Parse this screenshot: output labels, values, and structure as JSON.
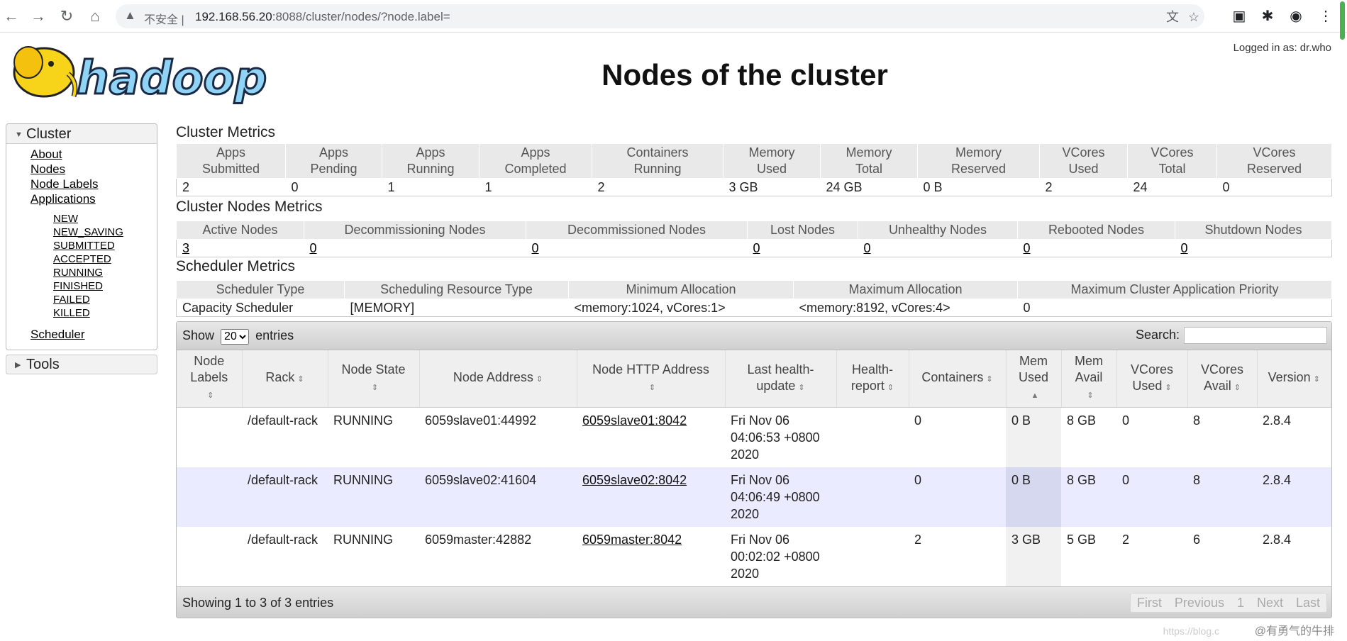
{
  "browser": {
    "insecure_label": "不安全 |",
    "url_host": "192.168.56.20",
    "url_rest": ":8088/cluster/nodes/?node.label="
  },
  "header": {
    "title": "Nodes of the cluster",
    "logged_in": "Logged in as: dr.who",
    "logo_text": "hadoop"
  },
  "sidebar": {
    "cluster_label": "Cluster",
    "links": [
      "About",
      "Nodes",
      "Node Labels",
      "Applications"
    ],
    "app_states": [
      "NEW",
      "NEW_SAVING",
      "SUBMITTED",
      "ACCEPTED",
      "RUNNING",
      "FINISHED",
      "FAILED",
      "KILLED"
    ],
    "scheduler_link": "Scheduler",
    "tools_label": "Tools"
  },
  "cluster_metrics": {
    "title": "Cluster Metrics",
    "headers": [
      [
        "Apps",
        "Submitted"
      ],
      [
        "Apps",
        "Pending"
      ],
      [
        "Apps",
        "Running"
      ],
      [
        "Apps",
        "Completed"
      ],
      [
        "Containers",
        "Running"
      ],
      [
        "Memory",
        "Used"
      ],
      [
        "Memory",
        "Total"
      ],
      [
        "Memory",
        "Reserved"
      ],
      [
        "VCores",
        "Used"
      ],
      [
        "VCores",
        "Total"
      ],
      [
        "VCores",
        "Reserved"
      ]
    ],
    "values": [
      "2",
      "0",
      "1",
      "1",
      "2",
      "3 GB",
      "24 GB",
      "0 B",
      "2",
      "24",
      "0"
    ]
  },
  "node_metrics": {
    "title": "Cluster Nodes Metrics",
    "headers": [
      "Active Nodes",
      "Decommissioning Nodes",
      "Decommissioned Nodes",
      "Lost Nodes",
      "Unhealthy Nodes",
      "Rebooted Nodes",
      "Shutdown Nodes"
    ],
    "values": [
      "3",
      "0",
      "0",
      "0",
      "0",
      "0",
      "0"
    ]
  },
  "scheduler_metrics": {
    "title": "Scheduler Metrics",
    "headers": [
      "Scheduler Type",
      "Scheduling Resource Type",
      "Minimum Allocation",
      "Maximum Allocation",
      "Maximum Cluster Application Priority"
    ],
    "values": [
      "Capacity Scheduler",
      "[MEMORY]",
      "<memory:1024, vCores:1>",
      "<memory:8192, vCores:4>",
      "0"
    ]
  },
  "nodes_table": {
    "show_label": "Show",
    "entries_label": "entries",
    "page_size": "20",
    "search_label": "Search:",
    "headers": [
      [
        "Node",
        "Labels"
      ],
      [
        "Rack"
      ],
      [
        "Node State"
      ],
      [
        "Node Address"
      ],
      [
        "Node HTTP Address"
      ],
      [
        "Last health-",
        "update"
      ],
      [
        "Health-",
        "report"
      ],
      [
        "Containers"
      ],
      [
        "Mem",
        "Used"
      ],
      [
        "Mem",
        "Avail"
      ],
      [
        "VCores",
        "Used"
      ],
      [
        "VCores",
        "Avail"
      ],
      [
        "Version"
      ]
    ],
    "rows": [
      {
        "labels": "",
        "rack": "/default-rack",
        "state": "RUNNING",
        "address": "6059slave01:44992",
        "http": "6059slave01:8042",
        "last_update": "Fri Nov 06 04:06:53 +0800 2020",
        "health": "",
        "containers": "0",
        "mem_used": "0 B",
        "mem_avail": "8 GB",
        "vcores_used": "0",
        "vcores_avail": "8",
        "version": "2.8.4"
      },
      {
        "labels": "",
        "rack": "/default-rack",
        "state": "RUNNING",
        "address": "6059slave02:41604",
        "http": "6059slave02:8042",
        "last_update": "Fri Nov 06 04:06:49 +0800 2020",
        "health": "",
        "containers": "0",
        "mem_used": "0 B",
        "mem_avail": "8 GB",
        "vcores_used": "0",
        "vcores_avail": "8",
        "version": "2.8.4"
      },
      {
        "labels": "",
        "rack": "/default-rack",
        "state": "RUNNING",
        "address": "6059master:42882",
        "http": "6059master:8042",
        "last_update": "Fri Nov 06 00:02:02 +0800 2020",
        "health": "",
        "containers": "2",
        "mem_used": "3 GB",
        "mem_avail": "5 GB",
        "vcores_used": "2",
        "vcores_avail": "6",
        "version": "2.8.4"
      }
    ],
    "info": "Showing 1 to 3 of 3 entries",
    "pager": [
      "First",
      "Previous",
      "1",
      "Next",
      "Last"
    ]
  },
  "watermark": "@有勇气的牛排",
  "watermark_url": "https://blog.c"
}
